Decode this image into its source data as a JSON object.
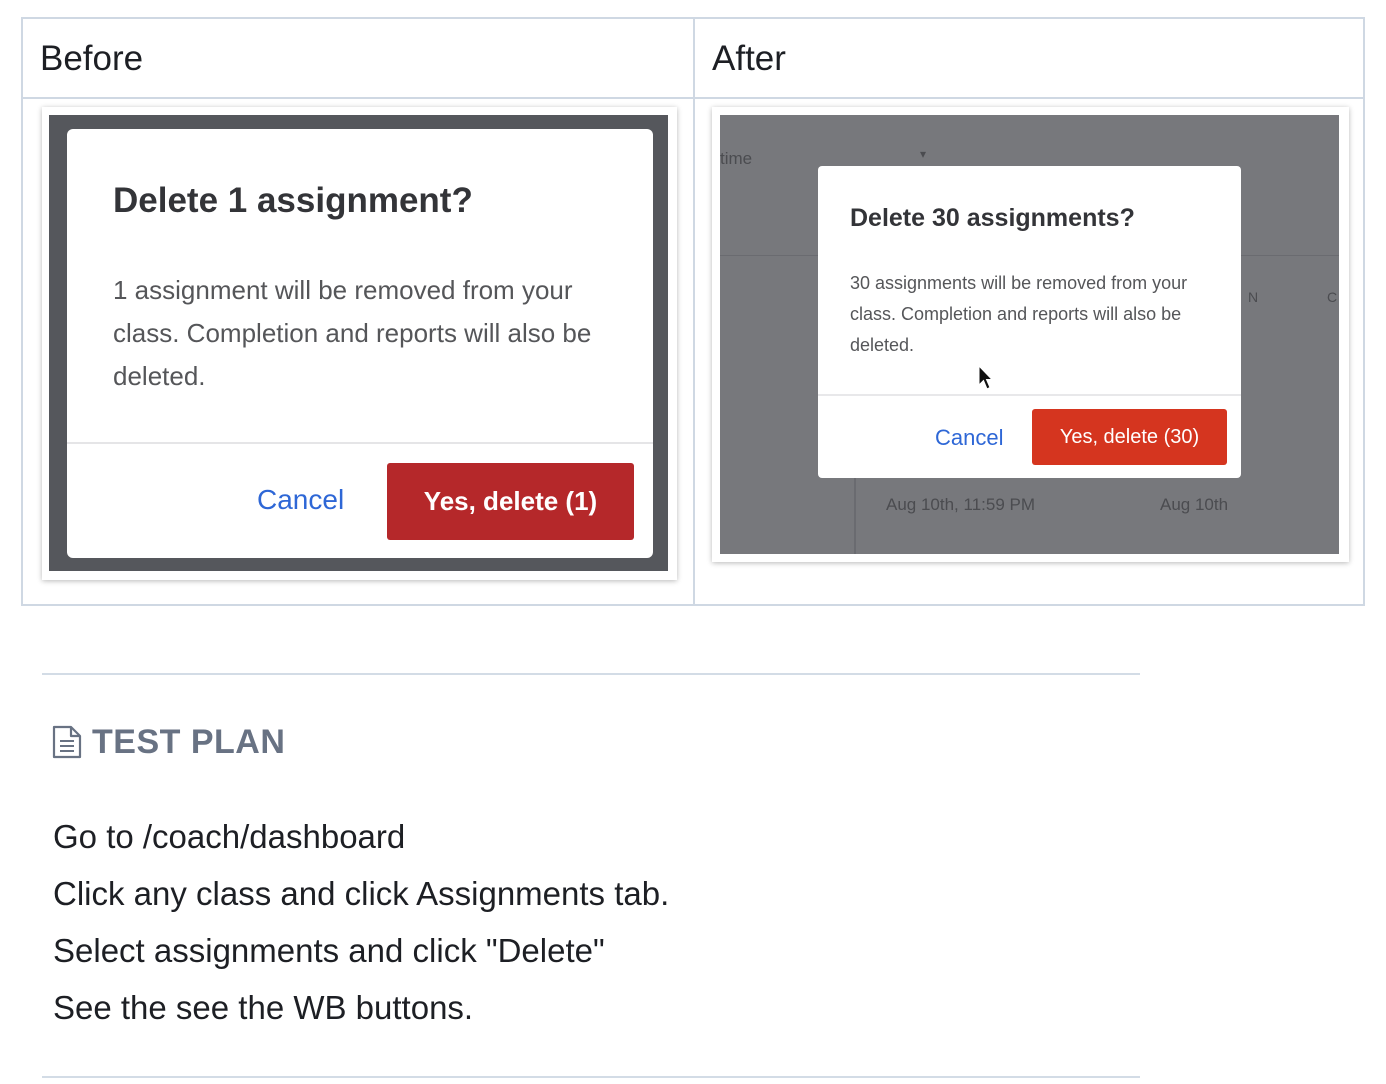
{
  "comparison": {
    "before_label": "Before",
    "after_label": "After",
    "before_dialog": {
      "title": "Delete 1 assignment?",
      "body": "1 assignment will be removed from your class. Completion and reports will also be deleted.",
      "cancel_label": "Cancel",
      "confirm_label": "Yes, delete (1)"
    },
    "after_dialog": {
      "title": "Delete 30 assignments?",
      "body": "30 assignments will be removed from your class. Completion and reports will also be deleted.",
      "cancel_label": "Cancel",
      "confirm_label": "Yes, delete (30)"
    },
    "after_background": {
      "header_fragment": "time",
      "col_fragment_n": "N",
      "col_fragment_c": "C",
      "row_date_left": "Aug 10th, 11:59 PM",
      "row_date_right": "Aug 10th"
    }
  },
  "test_plan": {
    "icon": "document-icon",
    "title": "TEST PLAN",
    "steps": [
      "Go to /coach/dashboard",
      "Click any class and click Assignments tab.",
      "Select assignments and click \"Delete\"",
      "See the see the WB buttons."
    ]
  },
  "colors": {
    "border": "#cfd8e3",
    "cancel_blue": "#2e67d6",
    "before_delete_red": "#b5282a",
    "after_delete_red": "#d5351f",
    "heading_gray": "#687283"
  }
}
